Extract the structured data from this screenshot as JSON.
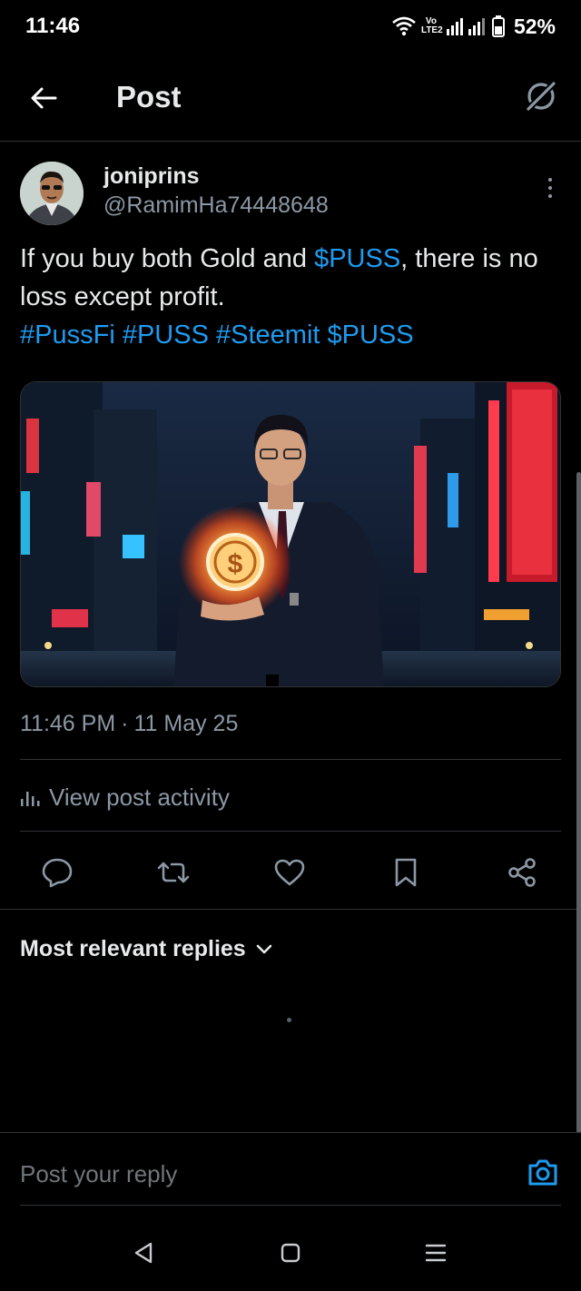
{
  "status_bar": {
    "time": "11:46",
    "network_label": "Vo LTE2",
    "battery": "52%"
  },
  "header": {
    "title": "Post",
    "back_icon": "arrow-left-icon",
    "grok_icon": "grok-icon"
  },
  "post": {
    "author": {
      "name": "joniprins",
      "handle": "@RamimHa74448648"
    },
    "text": {
      "part1": "If you buy both Gold and ",
      "cashtag1": "$PUSS",
      "part2": ", there is no loss except profit.",
      "tag1": "#PussFi",
      "tag2": "#PUSS",
      "tag3": "#Steemit",
      "cashtag2": "$PUSS"
    },
    "time": "11:46 PM",
    "separator": "·",
    "date": "11 May 25",
    "activity_label": "View post activity"
  },
  "actions": [
    "reply-icon",
    "repost-icon",
    "like-icon",
    "bookmark-icon",
    "share-icon"
  ],
  "replies": {
    "sort_label": "Most relevant replies"
  },
  "reply_bar": {
    "placeholder": "Post your reply"
  },
  "colors": {
    "accent": "#1d9bf0",
    "background": "#000000",
    "text": "#e7e9ea",
    "muted": "#8b98a5",
    "divider": "#2f3336"
  }
}
